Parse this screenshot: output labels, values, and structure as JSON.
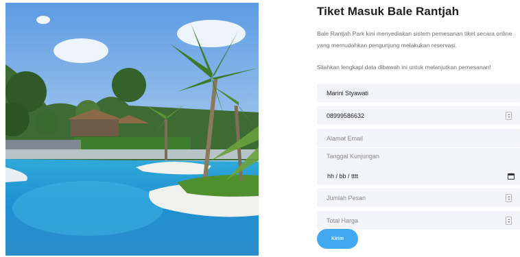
{
  "form": {
    "title": "Tiket Masuk Bale Rantjah",
    "description": "Bale Rantjah Park kini menyediakan sistem pemesanan tiket secara online yang memudahkan pengunjung melakukan reservasi.",
    "instruction": "Silahkan lengkapi data dibawah ini untuk melanjutkan pemesanan!",
    "name_value": "Marini Styawati",
    "phone_value": "08999586632",
    "email_placeholder": "Alamat Email",
    "date_label": "Tanggal Kunjungan",
    "date_value": "hh / bb / tttt",
    "quantity_placeholder": "Jumlah Pesan",
    "total_placeholder": "Total Harga",
    "submit_label": "Kirim"
  },
  "icons": {
    "phone_stepper": "spinner-icon",
    "quantity_stepper": "spinner-icon",
    "total_stepper": "spinner-icon",
    "date_picker": "calendar-icon"
  },
  "colors": {
    "accent": "#42a8ef",
    "field_background": "#f4f5f8"
  }
}
